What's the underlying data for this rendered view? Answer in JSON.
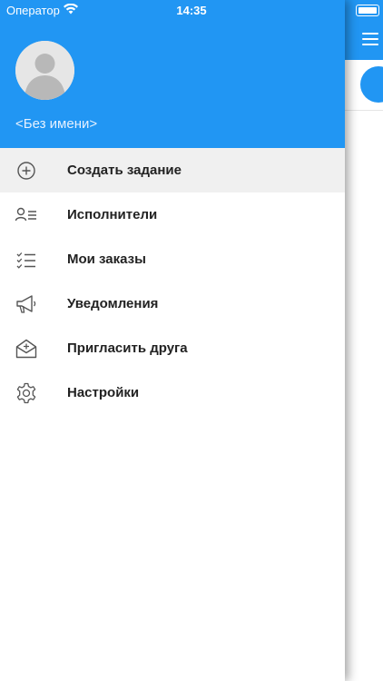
{
  "status_bar": {
    "carrier": "Оператор",
    "time": "14:35"
  },
  "profile": {
    "name": "<Без имени>"
  },
  "menu": {
    "items": [
      {
        "label": "Создать задание",
        "icon": "plus-circle-icon",
        "active": true
      },
      {
        "label": "Исполнители",
        "icon": "person-list-icon",
        "active": false
      },
      {
        "label": "Мои заказы",
        "icon": "checklist-icon",
        "active": false
      },
      {
        "label": "Уведомления",
        "icon": "megaphone-icon",
        "active": false
      },
      {
        "label": "Пригласить друга",
        "icon": "mail-invite-icon",
        "active": false
      },
      {
        "label": "Настройки",
        "icon": "gear-icon",
        "active": false
      }
    ]
  },
  "colors": {
    "accent": "#2196F3",
    "active_row": "#f0f0f0"
  }
}
